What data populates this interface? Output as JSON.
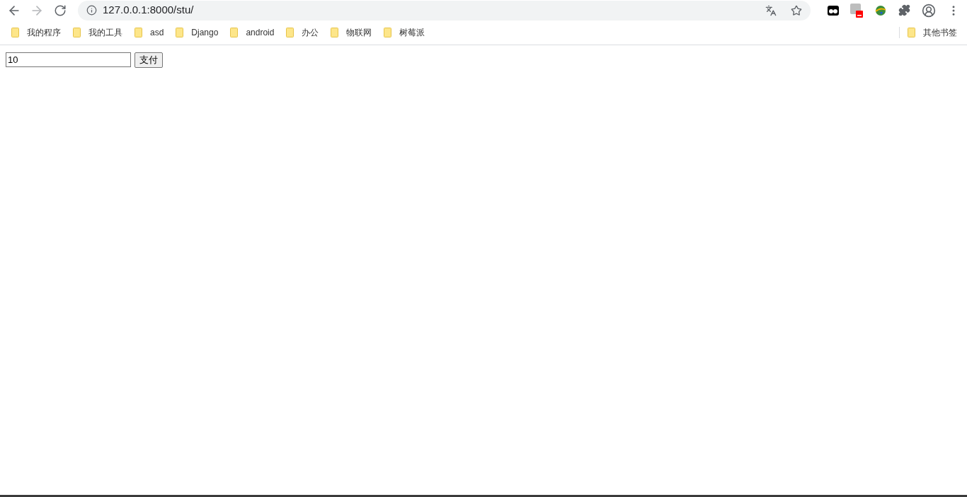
{
  "browser": {
    "url": "127.0.0.1:8000/stu/"
  },
  "bookmarks": [
    "我的程序",
    "我的工具",
    "asd",
    "Django",
    "android",
    "办公",
    "物联网",
    "树莓派"
  ],
  "other_bookmarks": "其他书签",
  "form": {
    "amount_value": "10",
    "submit_label": "支付"
  }
}
